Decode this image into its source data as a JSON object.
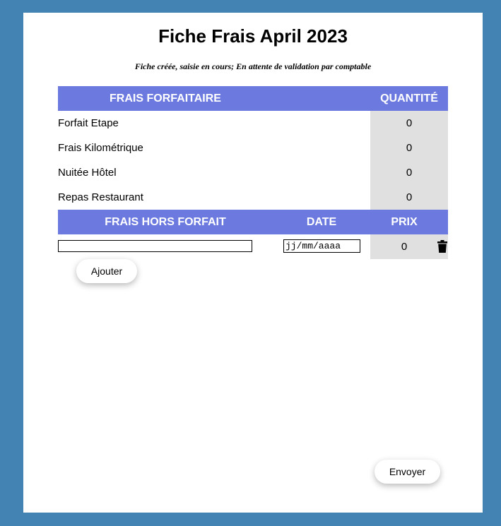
{
  "page": {
    "title": "Fiche Frais April 2023",
    "status": "Fiche créée, saisie en cours; En attente de validation par comptable"
  },
  "forfait_table": {
    "headers": {
      "label": "FRAIS FORFAITAIRE",
      "quantity": "QUANTITÉ"
    },
    "rows": [
      {
        "label": "Forfait Etape",
        "quantity": "0"
      },
      {
        "label": "Frais Kilométrique",
        "quantity": "0"
      },
      {
        "label": "Nuitée Hôtel",
        "quantity": "0"
      },
      {
        "label": "Repas Restaurant",
        "quantity": "0"
      }
    ]
  },
  "hors_forfait_table": {
    "headers": {
      "label": "FRAIS HORS FORFAIT",
      "date": "DATE",
      "price": "PRIX"
    },
    "rows": [
      {
        "label_value": "",
        "date_value": "jj/mm/aaaa",
        "price": "0",
        "delete_icon": "trash-icon"
      }
    ]
  },
  "actions": {
    "add_label": "Ajouter",
    "submit_label": "Envoyer"
  },
  "colors": {
    "background": "#4383b3",
    "header": "#6c7ae0",
    "cell": "#e0e0e0"
  }
}
